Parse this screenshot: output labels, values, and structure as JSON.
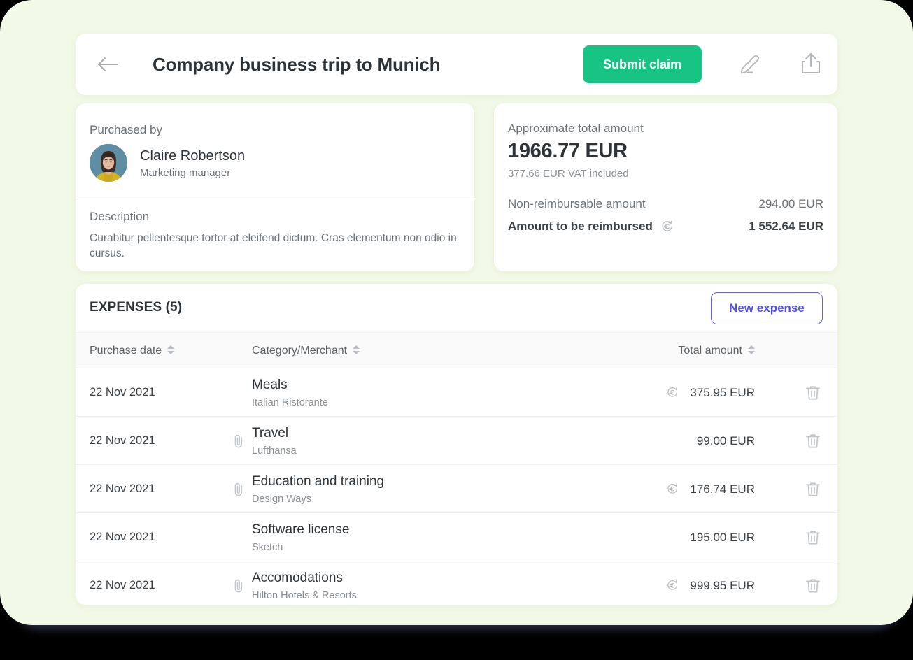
{
  "theme": {
    "page_background": "#000000",
    "panel_background": "#f2f9e6",
    "card_background": "#ffffff",
    "accent_green": "#17c484",
    "accent_indigo": "#4f4ff2",
    "text_primary": "#2e3338",
    "text_secondary": "#6b7176",
    "icon_grey": "#bfc3c7"
  },
  "header": {
    "back_icon": "arrow-left-icon",
    "title": "Company business trip to Munich",
    "submit_label": "Submit claim",
    "edit_icon": "pencil-icon",
    "share_icon": "share-upload-icon"
  },
  "purchaser": {
    "section_label": "Purchased by",
    "avatar_alt": "avatar",
    "name": "Claire Robertson",
    "role": "Marketing manager",
    "description_label": "Description",
    "description_text": "Curabitur pellentesque tortor at eleifend dictum. Cras elementum non odio in cursus."
  },
  "totals": {
    "approx_label": "Approximate total amount",
    "approx_value": "1966.77 EUR",
    "vat_note": "377.66 EUR VAT included",
    "nonreimbursable_label": "Non-reimbursable amount",
    "nonreimbursable_value": "294.00 EUR",
    "reimbursed_label": "Amount to be reimbursed",
    "reimbursed_icon": "euro-refund-icon",
    "reimbursed_value": "1 552.64 EUR"
  },
  "expenses": {
    "title": "EXPENSES (5)",
    "new_expense_label": "New expense",
    "columns": [
      {
        "key": "date",
        "label": "Purchase date"
      },
      {
        "key": "category",
        "label": "Category/Merchant"
      },
      {
        "key": "amount",
        "label": "Total amount"
      }
    ],
    "rows": [
      {
        "date": "22 Nov 2021",
        "category": "Meals",
        "merchant": "Italian Ristorante",
        "amount": "375.95 EUR",
        "has_attachment": false,
        "has_refund_icon": true
      },
      {
        "date": "22 Nov 2021",
        "category": "Travel",
        "merchant": "Lufthansa",
        "amount": "99.00 EUR",
        "has_attachment": true,
        "has_refund_icon": false
      },
      {
        "date": "22 Nov 2021",
        "category": "Education and training",
        "merchant": "Design Ways",
        "amount": "176.74 EUR",
        "has_attachment": true,
        "has_refund_icon": true
      },
      {
        "date": "22 Nov 2021",
        "category": "Software license",
        "merchant": "Sketch",
        "amount": "195.00 EUR",
        "has_attachment": false,
        "has_refund_icon": false
      },
      {
        "date": "22 Nov 2021",
        "category": "Accomodations",
        "merchant": "Hilton Hotels & Resorts",
        "amount": "999.95 EUR",
        "has_attachment": true,
        "has_refund_icon": true
      }
    ],
    "delete_icon": "trash-icon",
    "attachment_icon": "paperclip-icon",
    "refund_icon": "euro-refund-icon",
    "sort_icon": "sort-arrows-icon"
  }
}
